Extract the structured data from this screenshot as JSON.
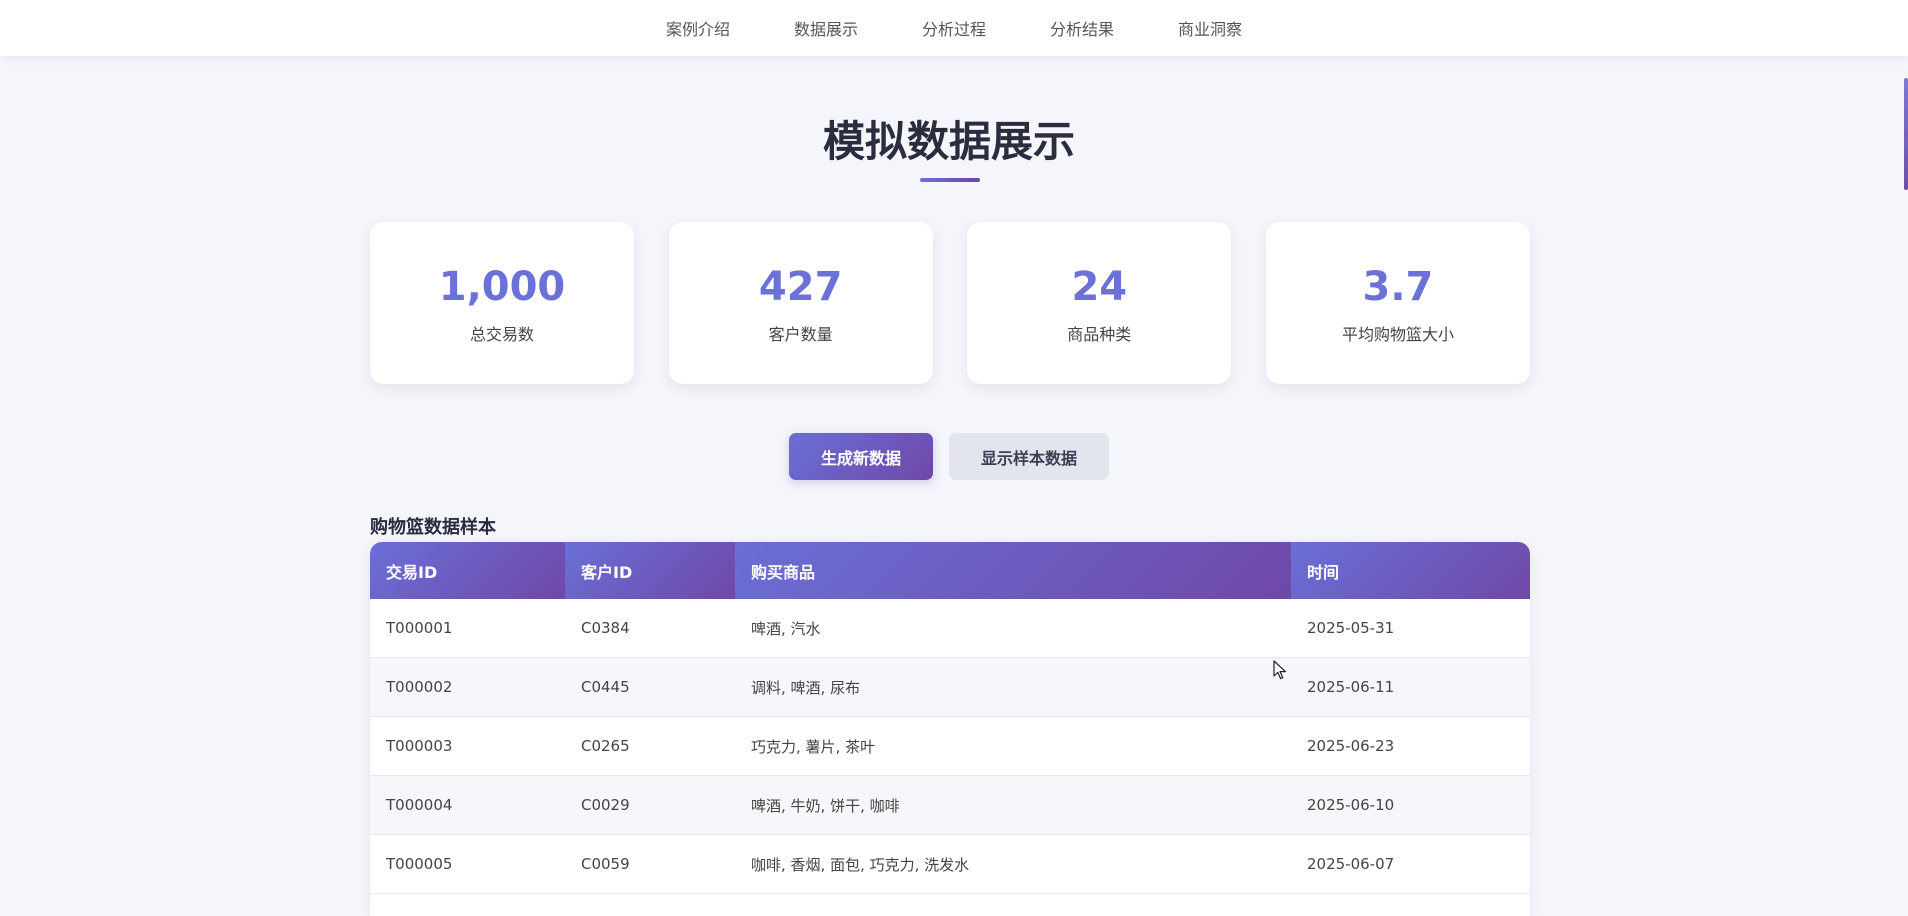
{
  "nav": {
    "items": [
      "案例介绍",
      "数据展示",
      "分析过程",
      "分析结果",
      "商业洞察"
    ]
  },
  "section": {
    "title": "模拟数据展示"
  },
  "stats": [
    {
      "value": "1,000",
      "label": "总交易数"
    },
    {
      "value": "427",
      "label": "客户数量"
    },
    {
      "value": "24",
      "label": "商品种类"
    },
    {
      "value": "3.7",
      "label": "平均购物篮大小"
    }
  ],
  "buttons": {
    "generate_label": "生成新数据",
    "show_sample_label": "显示样本数据"
  },
  "table": {
    "caption": "购物篮数据样本",
    "columns": [
      "交易ID",
      "客户ID",
      "购买商品",
      "时间"
    ],
    "rows": [
      [
        "T000001",
        "C0384",
        "啤酒, 汽水",
        "2025-05-31"
      ],
      [
        "T000002",
        "C0445",
        "调料, 啤酒, 尿布",
        "2025-06-11"
      ],
      [
        "T000003",
        "C0265",
        "巧克力, 薯片, 茶叶",
        "2025-06-23"
      ],
      [
        "T000004",
        "C0029",
        "啤酒, 牛奶, 饼干, 咖啡",
        "2025-06-10"
      ],
      [
        "T000005",
        "C0059",
        "咖啡, 香烟, 面包, 巧克力, 洗发水",
        "2025-06-07"
      ]
    ]
  },
  "colors": {
    "accent": "#6b71d6",
    "gradient_end": "#6f48a8",
    "background": "#f5f6fb"
  }
}
